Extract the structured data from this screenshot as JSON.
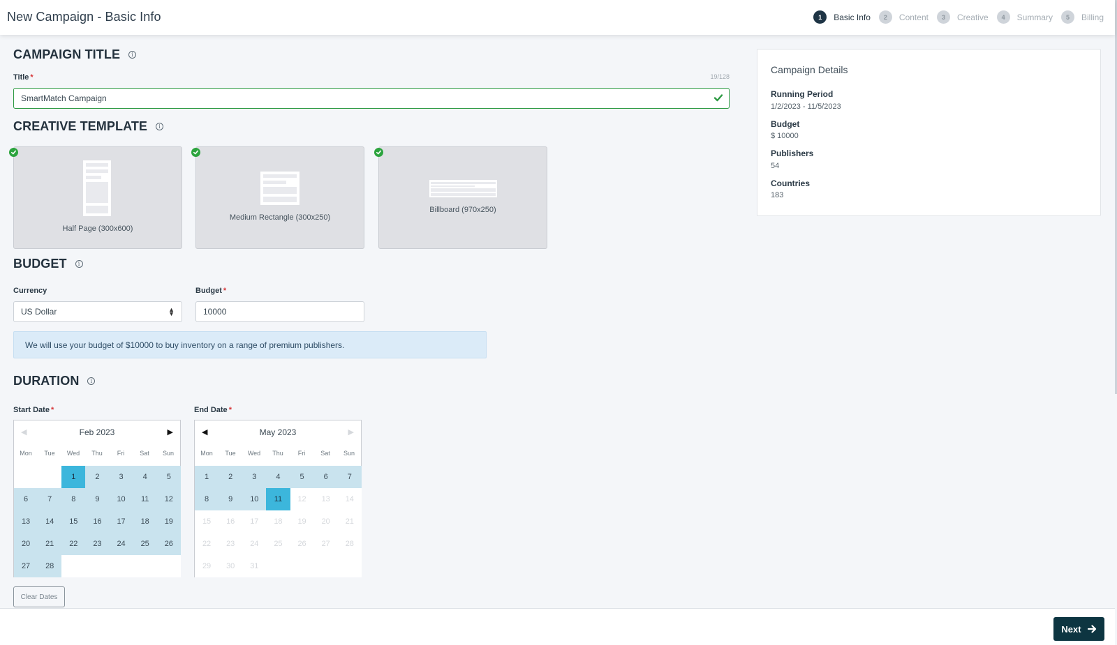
{
  "header": {
    "title": "New Campaign - Basic Info",
    "steps": [
      {
        "num": "1",
        "label": "Basic Info",
        "active": true
      },
      {
        "num": "2",
        "label": "Content",
        "active": false
      },
      {
        "num": "3",
        "label": "Creative",
        "active": false
      },
      {
        "num": "4",
        "label": "Summary",
        "active": false
      },
      {
        "num": "5",
        "label": "Billing",
        "active": false
      }
    ]
  },
  "campaign_title": {
    "heading": "CAMPAIGN TITLE",
    "info_icon": "info-icon",
    "field_label": "Title",
    "required_mark": "*",
    "value": "SmartMatch Campaign",
    "char_count": "19/128",
    "valid_icon": "checkmark-icon"
  },
  "creative_template": {
    "heading": "CREATIVE TEMPLATE",
    "templates": [
      {
        "label": "Half Page (300x600)",
        "selected": true
      },
      {
        "label": "Medium Rectangle (300x250)",
        "selected": true
      },
      {
        "label": "Billboard (970x250)",
        "selected": true
      }
    ]
  },
  "budget": {
    "heading": "BUDGET",
    "currency_label": "Currency",
    "currency_value": "US Dollar",
    "budget_label": "Budget",
    "required_mark": "*",
    "budget_value": "10000",
    "info_message": "We will use your budget of $10000 to buy inventory on a range of premium publishers."
  },
  "duration": {
    "heading": "DURATION",
    "start_label": "Start Date",
    "end_label": "End Date",
    "required_mark": "*",
    "weekdays": [
      "Mon",
      "Tue",
      "Wed",
      "Thu",
      "Fri",
      "Sat",
      "Sun"
    ],
    "start_calendar": {
      "month": "Feb 2023",
      "prev_enabled": false,
      "next_enabled": true,
      "leading_blanks": 2,
      "days_in_month": 28,
      "selected_day": 1,
      "range": [
        1,
        28
      ],
      "disabled_after": null
    },
    "end_calendar": {
      "month": "May 2023",
      "prev_enabled": true,
      "next_enabled": false,
      "leading_blanks": 0,
      "days_in_month": 31,
      "selected_day": 11,
      "range": [
        1,
        11
      ],
      "disabled_after": 11
    },
    "clear_label": "Clear Dates"
  },
  "details": {
    "title": "Campaign Details",
    "items": [
      {
        "label": "Running Period",
        "value": "1/2/2023 - 11/5/2023"
      },
      {
        "label": "Budget",
        "value": "$ 10000"
      },
      {
        "label": "Publishers",
        "value": "54"
      },
      {
        "label": "Countries",
        "value": "183"
      }
    ]
  },
  "footer": {
    "next_label": "Next",
    "next_icon": "arrow-right-icon"
  },
  "colors": {
    "accent_dark": "#0d3541",
    "step_active": "#1e3445",
    "success": "#2ca43e",
    "calendar_range": "#c9e3ee",
    "calendar_selected": "#3cb6dc",
    "alert_bg": "#dbebf8",
    "required": "#d63638"
  }
}
